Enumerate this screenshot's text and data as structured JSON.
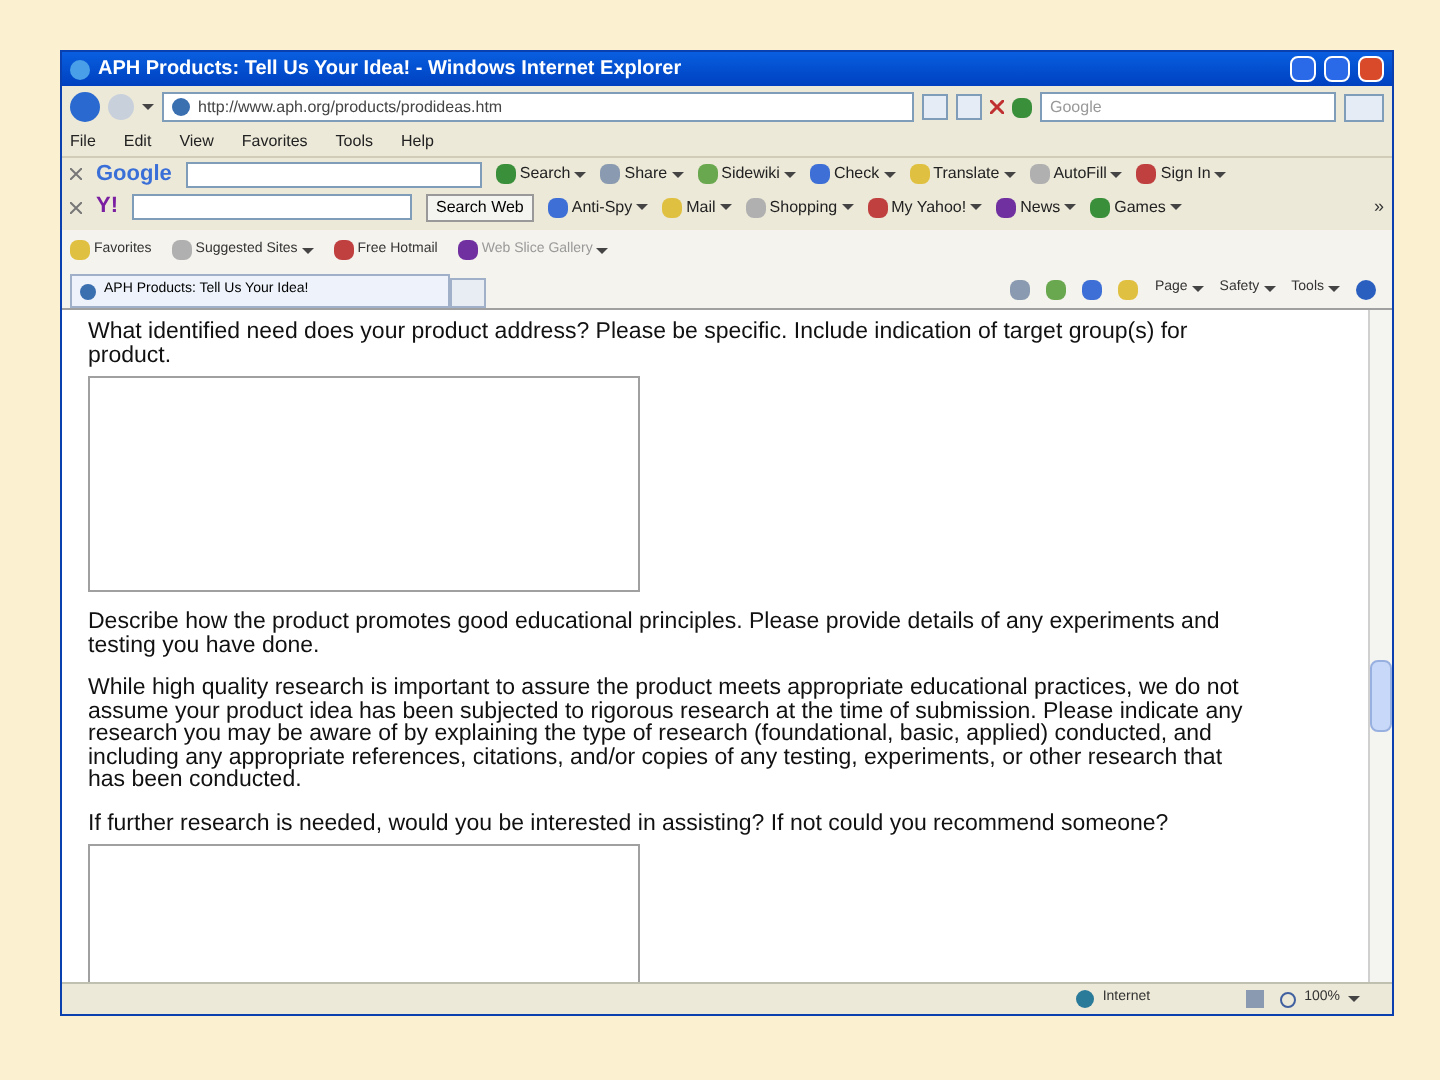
{
  "window": {
    "title": "APH Products: Tell Us Your Idea! - Windows Internet Explorer"
  },
  "address_bar": {
    "url": "http://www.aph.org/products/prodideas.htm"
  },
  "search_box": {
    "placeholder": "Google"
  },
  "menu": [
    "File",
    "Edit",
    "View",
    "Favorites",
    "Tools",
    "Help"
  ],
  "google_toolbar": {
    "logo": "Google",
    "items": [
      "Search",
      "Share",
      "Sidewiki",
      "Check",
      "Translate",
      "AutoFill",
      "Sign In"
    ]
  },
  "yahoo_toolbar": {
    "logo": "Y!",
    "search_button": "Search Web",
    "items": [
      "Anti-Spy",
      "Mail",
      "Shopping",
      "My Yahoo!",
      "News",
      "Games"
    ],
    "more": "»"
  },
  "favorites_bar": [
    "Favorites",
    "Suggested Sites",
    "Free Hotmail",
    "Web Slice Gallery"
  ],
  "tabs": [
    {
      "label": "APH Products: Tell Us Your Idea!",
      "selected": true
    }
  ],
  "command_bar": [
    "Page",
    "Safety",
    "Tools"
  ],
  "content": [
    {
      "kind": "text",
      "text": "What identified need does your product address? Please be specific. Include indication of target group(s) for product."
    },
    {
      "kind": "textarea"
    },
    {
      "kind": "text",
      "text": "Describe how the product promotes good educational principles. Please provide details of any experiments and testing you have done."
    },
    {
      "kind": "text",
      "text": "While high quality research is important to assure the product meets appropriate educational practices, we do not assume your product idea has been subjected to rigorous research at the time of submission. Please indicate any research you may be aware of by explaining the type of research (foundational, basic, applied) conducted, and including any appropriate references, citations, and/or copies of any testing, experiments, or other research that has been conducted."
    },
    {
      "kind": "text",
      "text": "If further research is needed, would you be interested in assisting? If not could you recommend someone?"
    },
    {
      "kind": "textarea"
    }
  ],
  "status_bar": {
    "zone": "Internet",
    "zoom": "100%"
  }
}
